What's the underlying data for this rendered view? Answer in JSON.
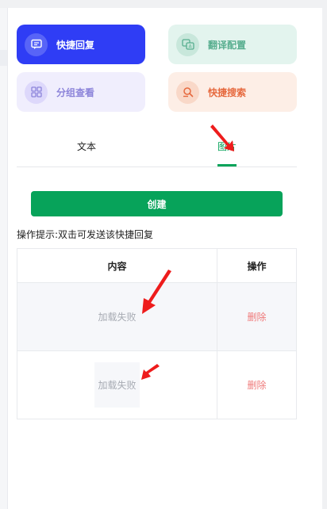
{
  "quick_actions": [
    {
      "label": "快捷回复",
      "icon": "chat-icon",
      "color": "#2f3df5"
    },
    {
      "label": "翻译配置",
      "icon": "translate-icon",
      "color": "#58ae8f"
    },
    {
      "label": "分组查看",
      "icon": "grid-icon",
      "color": "#8c84da"
    },
    {
      "label": "快捷搜索",
      "icon": "search-icon",
      "color": "#e6693e"
    }
  ],
  "tabs": [
    {
      "label": "文本",
      "active": false
    },
    {
      "label": "图片",
      "active": true
    }
  ],
  "create_button": "创建",
  "hint": "操作提示:双击可发送该快捷回复",
  "table": {
    "headers": [
      "内容",
      "操作"
    ],
    "rows": [
      {
        "content": "加载失败",
        "action": "删除"
      },
      {
        "content": "加载失败",
        "action": "删除"
      }
    ]
  },
  "colors": {
    "accent": "#07a35a",
    "delete": "#ef7a7a",
    "annotation_arrow": "#ee1c1c"
  }
}
